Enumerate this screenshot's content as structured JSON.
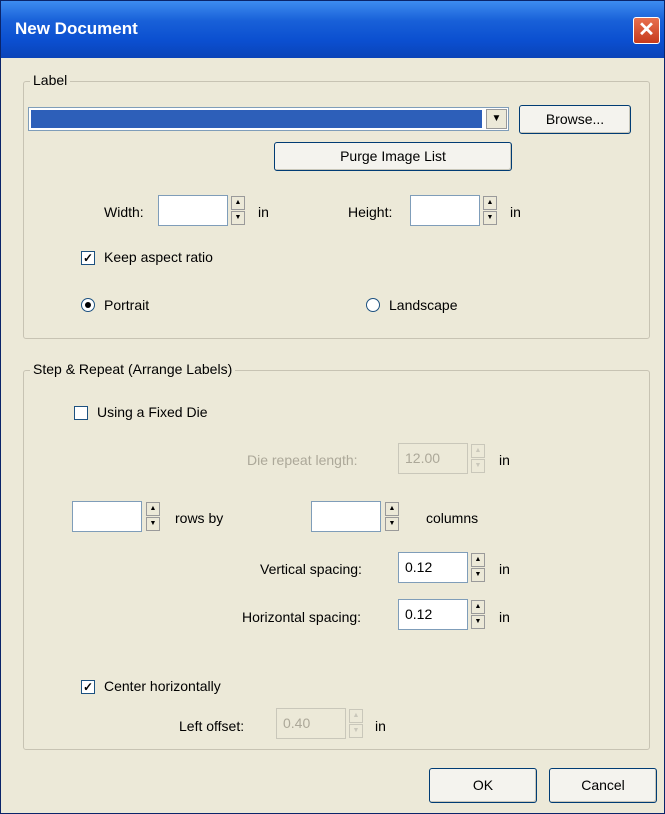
{
  "window": {
    "title": "New Document",
    "close_glyph": "✕"
  },
  "label_group": {
    "legend": "Label",
    "image_combo": {
      "selected": ""
    },
    "browse_label": "Browse...",
    "purge_label": "Purge Image List",
    "width_label": "Width:",
    "width_value": "",
    "width_unit": "in",
    "height_label": "Height:",
    "height_value": "",
    "height_unit": "in",
    "keep_aspect_label": "Keep aspect ratio",
    "keep_aspect_checked": true,
    "portrait_label": "Portrait",
    "landscape_label": "Landscape",
    "orientation": "Portrait"
  },
  "step_group": {
    "legend": "Step & Repeat (Arrange Labels)",
    "fixed_die_label": "Using a Fixed Die",
    "fixed_die_checked": false,
    "die_repeat_label": "Die repeat length:",
    "die_repeat_value": "12.00",
    "die_repeat_unit": "in",
    "rows_value": "",
    "rows_label": "rows by",
    "columns_value": "",
    "columns_label": "columns",
    "vertical_spacing_label": "Vertical spacing:",
    "vertical_spacing_value": "0.12",
    "vertical_spacing_unit": "in",
    "horizontal_spacing_label": "Horizontal spacing:",
    "horizontal_spacing_value": "0.12",
    "horizontal_spacing_unit": "in",
    "center_label": "Center horizontally",
    "center_checked": true,
    "left_offset_label": "Left offset:",
    "left_offset_value": "0.40",
    "left_offset_unit": "in"
  },
  "footer": {
    "ok_label": "OK",
    "cancel_label": "Cancel"
  },
  "colors": {
    "titlebar": "#0b4fd0",
    "dialog_bg": "#ece9d8",
    "combo_selection": "#2d5fb9",
    "close_button": "#d44a2a"
  },
  "icons": {
    "check": "✓",
    "spin_up": "▲",
    "spin_down": "▼",
    "dropdown": "▼"
  }
}
